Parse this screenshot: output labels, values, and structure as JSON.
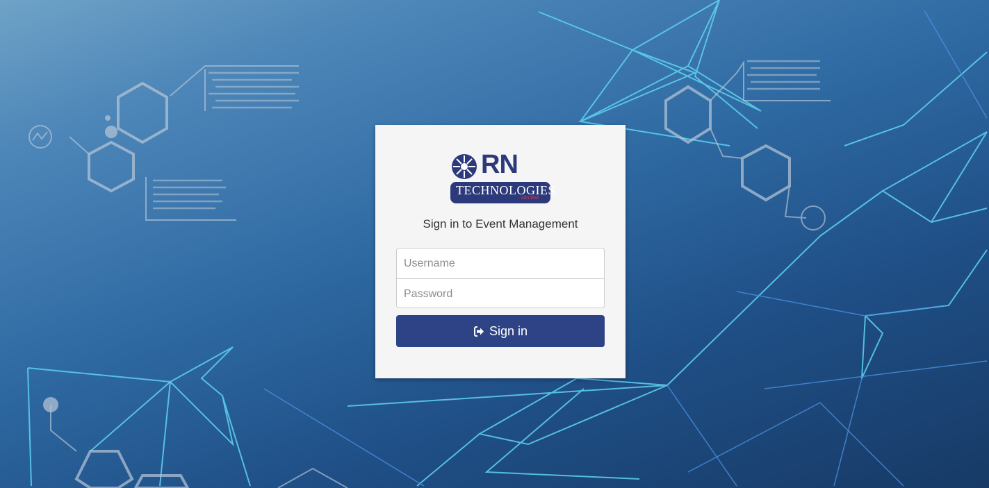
{
  "brand": {
    "logo_main": "RN",
    "logo_band": "TECHNOLOGIES",
    "logo_sub": "sdn bhd"
  },
  "login": {
    "title": "Sign in to Event Management",
    "username_placeholder": "Username",
    "password_placeholder": "Password",
    "signin_label": "Sign in",
    "signin_icon": "sign-in-icon"
  },
  "colors": {
    "button": "#2e4385",
    "card": "#f5f5f5",
    "background": "#2f6aa3"
  }
}
